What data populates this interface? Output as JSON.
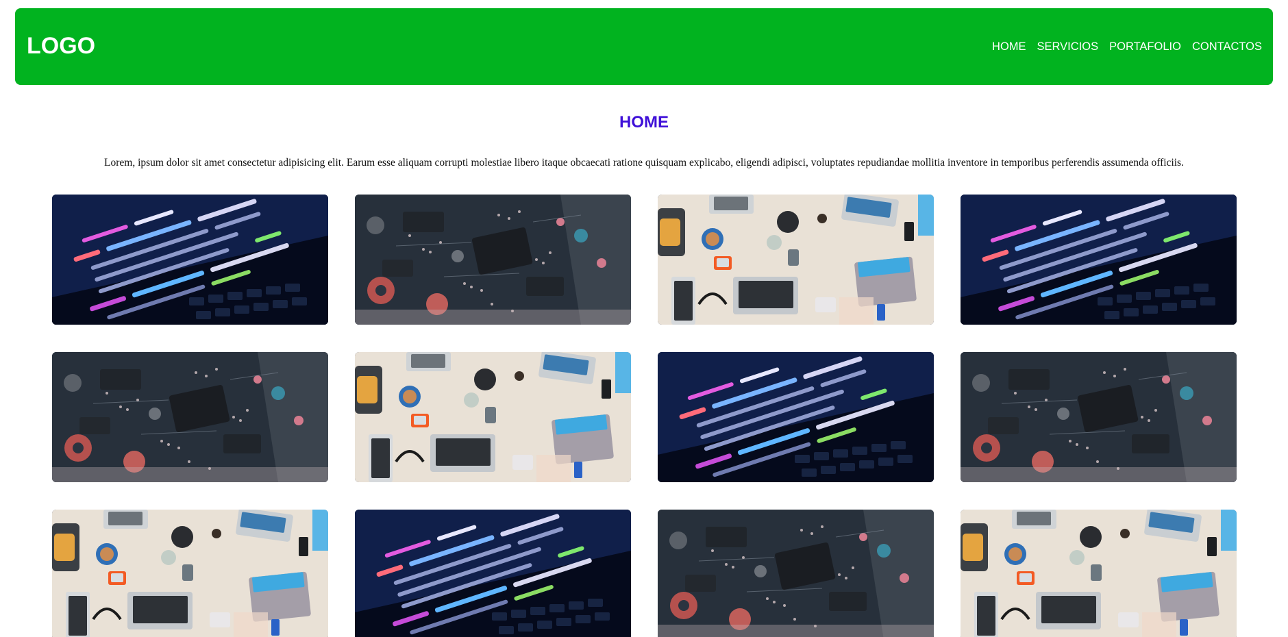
{
  "header": {
    "logo": "LOGO",
    "nav": [
      {
        "label": "HOME"
      },
      {
        "label": "SERVICIOS"
      },
      {
        "label": "PORTAFOLIO"
      },
      {
        "label": "CONTACTOS"
      }
    ]
  },
  "main": {
    "title": "HOME",
    "intro": "Lorem, ipsum dolor sit amet consectetur adipisicing elit. Earum esse aliquam corrupti molestiae libero itaque obcaecati ratione quisquam explicabo, eligendi adipisci, voluptates repudiandae mollitia inventore in temporibus perferendis assumenda officiis."
  },
  "colors": {
    "header_bg": "#01b31f",
    "title": "#3f10d8"
  },
  "gallery": [
    {
      "kind": "code"
    },
    {
      "kind": "circuit"
    },
    {
      "kind": "desk"
    },
    {
      "kind": "code"
    },
    {
      "kind": "circuit"
    },
    {
      "kind": "desk"
    },
    {
      "kind": "code"
    },
    {
      "kind": "circuit"
    },
    {
      "kind": "desk"
    },
    {
      "kind": "code"
    },
    {
      "kind": "circuit"
    },
    {
      "kind": "desk"
    }
  ]
}
